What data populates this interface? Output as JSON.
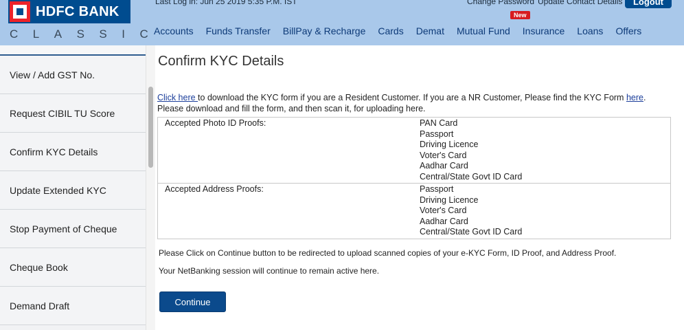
{
  "header": {
    "logo_name": "HDFC BANK",
    "logo_sub": "CLASSIC",
    "last_login": "Last Log in: Jun 25 2019 5:35 P.M. IST",
    "change_password": "Change Password",
    "update_contact": "Update Contact Details",
    "logout": "Logout",
    "new_badge": "New",
    "nav": [
      "Accounts",
      "Funds Transfer",
      "BillPay & Recharge",
      "Cards",
      "Demat",
      "Mutual Fund",
      "Insurance",
      "Loans",
      "Offers"
    ]
  },
  "sidebar": {
    "items": [
      "View / Add GST No.",
      "Request CIBIL TU Score",
      "Confirm KYC Details",
      "Update Extended KYC",
      "Stop Payment of Cheque",
      "Cheque Book",
      "Demand Draft"
    ]
  },
  "main": {
    "title": "Confirm KYC Details",
    "intro": {
      "click_here": "Click here ",
      "text1": "to download the KYC form if you are a Resident Customer. If you are a NR Customer, Please find the KYC Form ",
      "here": "here",
      "text2": ".",
      "line2": "Please download and fill the form, and then scan it, for uploading here."
    },
    "photo_label": "Accepted Photo ID Proofs:",
    "photo_proofs": [
      "PAN Card",
      "Passport",
      "Driving Licence",
      "Voter's Card",
      "Aadhar Card",
      "Central/State Govt ID Card"
    ],
    "address_label": "Accepted Address Proofs:",
    "address_proofs": [
      "Passport",
      "Driving Licence",
      "Voter's Card",
      "Aadhar Card",
      "Central/State Govt ID Card"
    ],
    "note1": "Please Click on Continue button to be redirected to upload scanned copies of your e-KYC Form, ID Proof, and Address Proof.",
    "note2": "Your NetBanking session will continue to remain active here.",
    "continue": "Continue"
  },
  "colors": {
    "header_bg": "#a9c8ea",
    "brand_blue": "#004c8f",
    "brand_red": "#ed232a",
    "nav_text": "#0d3a78",
    "button_blue": "#0b4a8c"
  }
}
